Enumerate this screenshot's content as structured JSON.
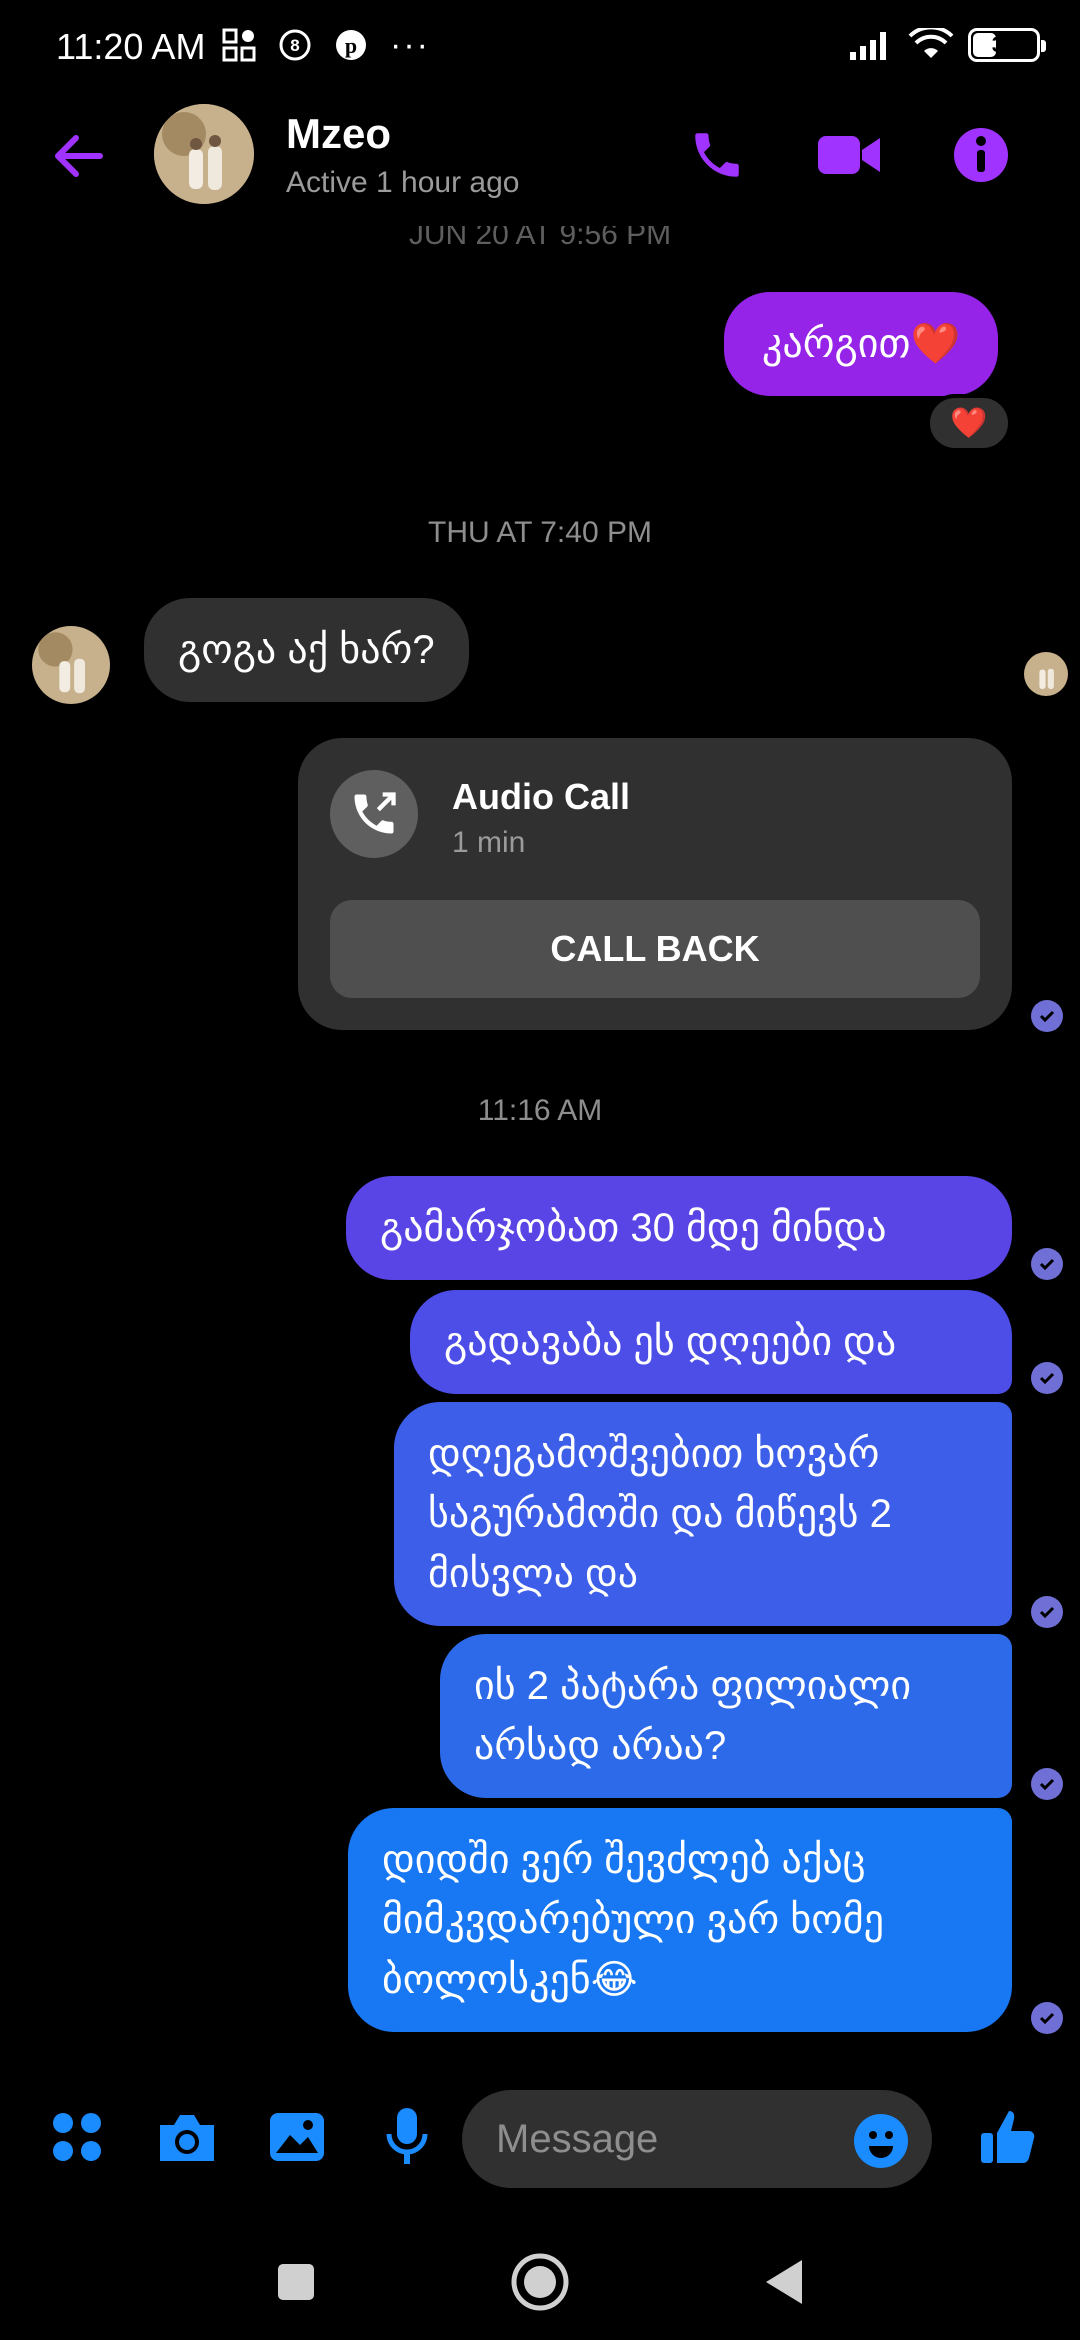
{
  "status_bar": {
    "time": "11:20 AM",
    "battery": "37",
    "battery_level": 0.37,
    "icons": [
      "apps-grid-icon",
      "number-8-icon",
      "pinterest-icon",
      "more-dots-icon",
      "signal-icon",
      "wifi-icon",
      "battery-icon"
    ]
  },
  "header": {
    "name": "Mzeo",
    "status": "Active 1 hour ago",
    "accent": "#a033ff"
  },
  "messages": {
    "partial_timestamp": "JUN 20 AT 9:56 PM",
    "out_1": "კარგით❤️",
    "reaction_1": "❤️",
    "time_thu": "THU AT 7:40 PM",
    "in_1": "გოგა აქ ხარ?",
    "call_title": "Audio Call",
    "call_duration": "1 min",
    "call_back": "CALL BACK",
    "time_today": "11:16 AM",
    "out_2": "გამარჯობათ 30 მდე მინდა",
    "out_3": "გადავაბა ეს დღეები და",
    "out_4_line1": "დღეგამოშვებით ხოვარ",
    "out_4_line2": "საგურამოში და მიწევს 2",
    "out_4_line3": "მისვლა და",
    "out_5_line1": "ის 2 პატარა ფილიალი",
    "out_5_line2": "არსად არაა?",
    "out_6_line1": "დიდში ვერ შევძლებ აქაც",
    "out_6_line2": "მიმკვდარებული ვარ ხომე",
    "out_6_line3": "ბოლოსკენ😂"
  },
  "composer": {
    "placeholder": "Message",
    "accent": "#1a8cff"
  },
  "colors": {
    "bubble_purple": "#8a2be2",
    "bubble_blue": "#1877f2",
    "incoming": "#303030"
  }
}
